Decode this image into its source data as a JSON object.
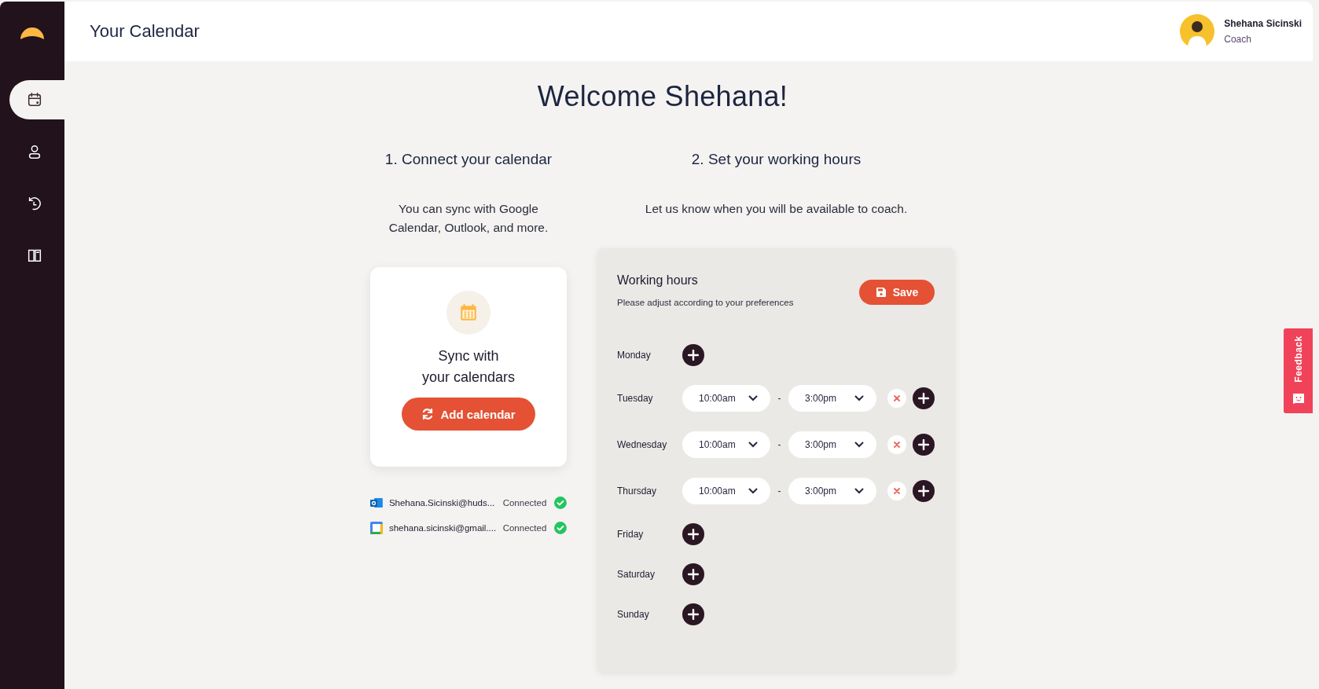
{
  "sidebar": {
    "items": [
      {
        "kind": "calendar",
        "selected": true
      },
      {
        "kind": "person",
        "selected": false
      },
      {
        "kind": "history",
        "selected": false
      },
      {
        "kind": "book",
        "selected": false
      }
    ]
  },
  "header": {
    "title": "Your Calendar",
    "user": {
      "name": "Shehana Sicinski",
      "role": "Coach"
    }
  },
  "welcome": "Welcome Shehana!",
  "connect": {
    "heading": "1. Connect your calendar",
    "description": "You can sync with Google Calendar, Outlook, and more.",
    "card": {
      "title_lines": [
        "Sync with",
        "your calendars"
      ],
      "button": "Add calendar"
    },
    "accounts": [
      {
        "kind": "outlook",
        "email": "Shehana.Sicinski@huds...",
        "status": "Connected"
      },
      {
        "kind": "google",
        "email": "shehana.sicinski@gmail....",
        "status": "Connected"
      }
    ]
  },
  "hours": {
    "heading": "2. Set your working hours",
    "description": "Let us know when you will be available to coach.",
    "panel": {
      "title": "Working hours",
      "subtitle": "Please adjust according to your preferences",
      "save": "Save",
      "separator": "-",
      "days": [
        {
          "name": "Monday"
        },
        {
          "name": "Tuesday",
          "slots": [
            {
              "start": "10:00am",
              "end": "3:00pm"
            }
          ]
        },
        {
          "name": "Wednesday",
          "slots": [
            {
              "start": "10:00am",
              "end": "3:00pm"
            }
          ]
        },
        {
          "name": "Thursday",
          "slots": [
            {
              "start": "10:00am",
              "end": "3:00pm"
            }
          ]
        },
        {
          "name": "Friday"
        },
        {
          "name": "Saturday"
        },
        {
          "name": "Sunday"
        }
      ]
    }
  },
  "feedback": "Feedback"
}
